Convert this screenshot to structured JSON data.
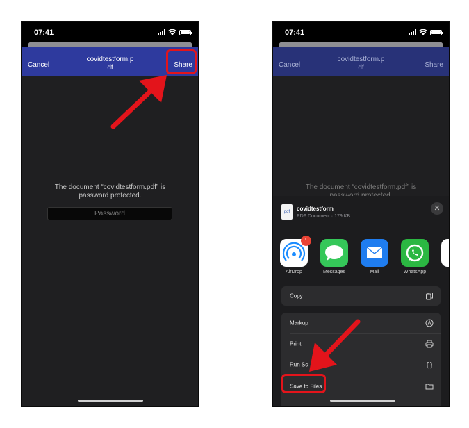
{
  "left_phone": {
    "status": {
      "time": "07:41"
    },
    "nav": {
      "cancel_label": "Cancel",
      "title_line1": "covidtestform.p",
      "title_line2": "df",
      "share_label": "Share"
    },
    "message_line1": "The document “covidtestform.pdf” is",
    "message_line2": "password protected.",
    "password_placeholder": "Password"
  },
  "right_phone": {
    "status": {
      "time": "07:41"
    },
    "nav": {
      "cancel_label": "Cancel",
      "title_line1": "covidtestform.p",
      "title_line2": "df",
      "share_label": "Share"
    },
    "message_line1": "The document “covidtestform.pdf” is",
    "message_line2": "password protected.",
    "share_sheet": {
      "file_thumb_label": "pdf",
      "file_name": "covidtestform",
      "file_meta": "PDF Document · 179 KB",
      "close_glyph": "✕",
      "apps": [
        {
          "label": "AirDrop",
          "icon": "airdrop-icon",
          "badge": "1"
        },
        {
          "label": "Messages",
          "icon": "messages-icon"
        },
        {
          "label": "Mail",
          "icon": "mail-icon"
        },
        {
          "label": "WhatsApp",
          "icon": "whatsapp-icon"
        }
      ],
      "actions": [
        {
          "label": "Copy",
          "icon": "copy-icon"
        },
        {
          "label": "Markup",
          "icon": "markup-icon"
        },
        {
          "label": "Print",
          "icon": "printer-icon"
        },
        {
          "label": "Run Sc",
          "icon": "shortcuts-icon"
        },
        {
          "label": "Save to Files",
          "icon": "folder-icon"
        }
      ]
    }
  },
  "colors": {
    "highlight": "#e3141b",
    "nav_bar": "#2e3a9e"
  }
}
